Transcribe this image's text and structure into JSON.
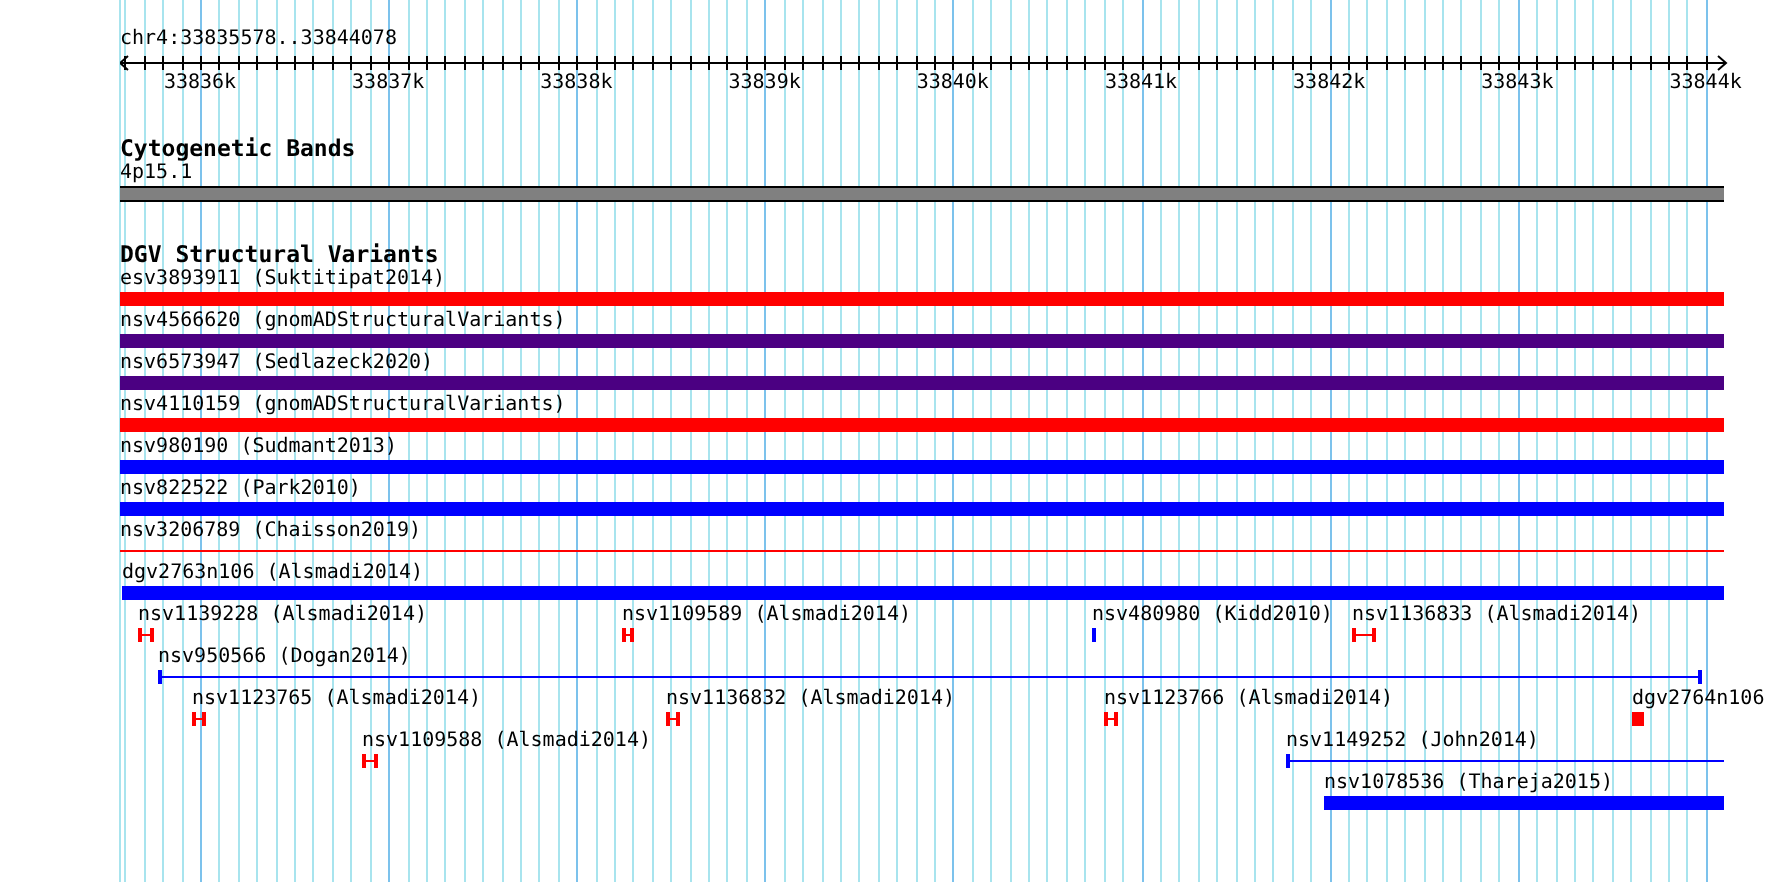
{
  "ruler": {
    "location": "chr4:33835578..33844078",
    "ticks": [
      "33836k",
      "33837k",
      "33838k",
      "33839k",
      "33840k",
      "33841k",
      "33842k",
      "33843k",
      "33844k"
    ]
  },
  "cytobands": {
    "title": "Cytogenetic Bands",
    "band": {
      "label": "4p15.1",
      "color": "#808080"
    }
  },
  "dgv": {
    "title": "DGV Structural Variants",
    "features": [
      {
        "label": "esv3893911 (Suktitipat2014)",
        "kind": "bar",
        "color": "#ff0000"
      },
      {
        "label": "nsv4566620 (gnomADStructuralVariants)",
        "kind": "bar",
        "color": "#4b0082"
      },
      {
        "label": "nsv6573947 (Sedlazeck2020)",
        "kind": "bar",
        "color": "#4b0082"
      },
      {
        "label": "nsv4110159 (gnomADStructuralVariants)",
        "kind": "bar",
        "color": "#ff0000"
      },
      {
        "label": "nsv980190 (Sudmant2013)",
        "kind": "bar",
        "color": "#0000ff"
      },
      {
        "label": "nsv822522 (Park2010)",
        "kind": "bar",
        "color": "#0000ff"
      },
      {
        "label": "nsv3206789 (Chaisson2019)",
        "kind": "line",
        "color": "#ff0000"
      },
      {
        "label": "dgv2763n106 (Alsmadi2014)",
        "kind": "bar",
        "color": "#0000ff"
      },
      {
        "label": "nsv1139228 (Alsmadi2014)",
        "kind": "marker",
        "color": "#ff0000"
      },
      {
        "label": "nsv1109589 (Alsmadi2014)",
        "kind": "marker",
        "color": "#ff0000"
      },
      {
        "label": "nsv480980 (Kidd2010)",
        "kind": "bar",
        "color": "#0000ff"
      },
      {
        "label": "nsv1136833 (Alsmadi2014)",
        "kind": "marker",
        "color": "#ff0000"
      },
      {
        "label": "nsv950566 (Dogan2014)",
        "kind": "span",
        "color": "#0000ff"
      },
      {
        "label": "nsv1123765 (Alsmadi2014)",
        "kind": "marker",
        "color": "#ff0000"
      },
      {
        "label": "nsv1136832 (Alsmadi2014)",
        "kind": "marker",
        "color": "#ff0000"
      },
      {
        "label": "nsv1123766 (Alsmadi2014)",
        "kind": "marker",
        "color": "#ff0000"
      },
      {
        "label": "dgv2764n106",
        "kind": "bar",
        "color": "#ff0000"
      },
      {
        "label": "nsv1109588 (Alsmadi2014)",
        "kind": "marker",
        "color": "#ff0000"
      },
      {
        "label": "nsv1149252 (John2014)",
        "kind": "span",
        "color": "#0000ff"
      },
      {
        "label": "nsv1078536 (Thareja2015)",
        "kind": "bar",
        "color": "#0000ff"
      }
    ]
  }
}
